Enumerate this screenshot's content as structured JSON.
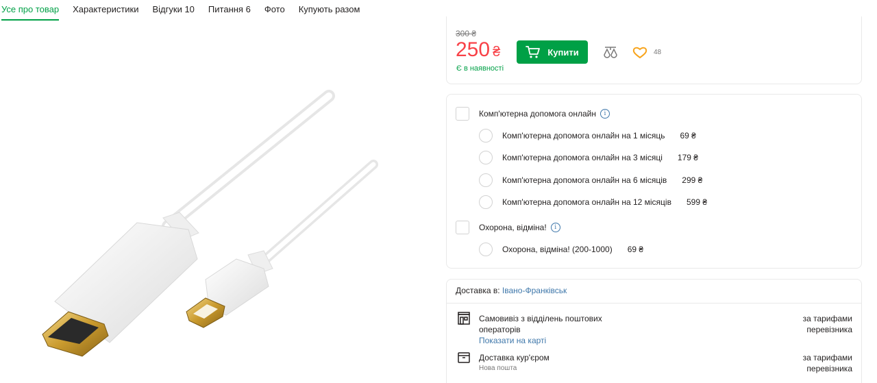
{
  "tabs": [
    {
      "label": "Усе про товар",
      "active": true
    },
    {
      "label": "Характеристики",
      "active": false
    },
    {
      "label": "Відгуки 10",
      "active": false
    },
    {
      "label": "Питання 6",
      "active": false
    },
    {
      "label": "Фото",
      "active": false
    },
    {
      "label": "Купують разом",
      "active": false
    }
  ],
  "price": {
    "old": "300 ₴",
    "current": "250",
    "currency": "₴",
    "stock": "Є в наявності",
    "buy_label": "Купити",
    "wishlist_count": "48"
  },
  "services": {
    "groups": [
      {
        "label": "Комп'ютерна допомога онлайн",
        "options": [
          {
            "label": "Комп'ютерна допомога онлайн на 1 місяць",
            "price": "69 ₴"
          },
          {
            "label": "Комп'ютерна допомога онлайн на 3 місяці",
            "price": "179 ₴"
          },
          {
            "label": "Комп'ютерна допомога онлайн на 6 місяців",
            "price": "299 ₴"
          },
          {
            "label": "Комп'ютерна допомога онлайн на 12 місяців",
            "price": "599 ₴"
          }
        ]
      },
      {
        "label": "Охорона, відміна!",
        "options": [
          {
            "label": "Охорона, відміна! (200-1000)",
            "price": "69 ₴"
          }
        ]
      }
    ],
    "info_glyph": "i"
  },
  "delivery": {
    "prefix": "Доставка в:",
    "city": "Івано-Франківськ",
    "pickup": {
      "title": "Самовивіз з відділень поштових операторів",
      "link": "Показати на карті",
      "price": "за тарифами перевізника"
    },
    "courier": {
      "title": "Доставка кур'єром",
      "subtitle": "Нова пошта",
      "price": "за тарифами перевізника"
    }
  },
  "colors": {
    "accent": "#00a046",
    "price_red": "#f84147",
    "link": "#3e77aa",
    "wish": "#f8a41c"
  }
}
